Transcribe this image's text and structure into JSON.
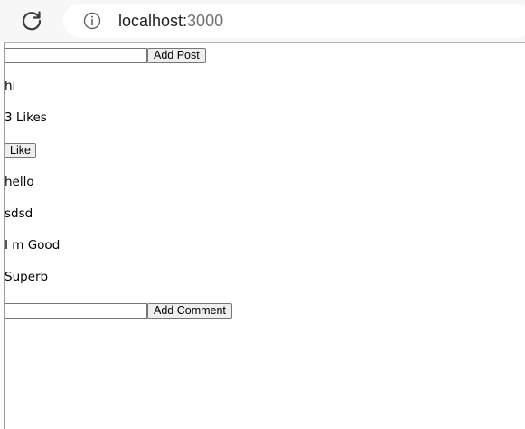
{
  "browser": {
    "url_host": "localhost:",
    "url_port": "3000"
  },
  "page": {
    "post_input_value": "",
    "add_post_label": "Add Post",
    "post_text": "hi",
    "likes_text": "3 Likes",
    "like_label": "Like",
    "comments": [
      "hello",
      "sdsd",
      "I m Good",
      "Superb"
    ],
    "comment_input_value": "",
    "add_comment_label": "Add Comment"
  },
  "colors": {
    "toolbar_bg": "#f7f7f7",
    "button_bg": "#efefef",
    "border": "#767676"
  },
  "icons": {
    "reload": "reload-icon",
    "info": "info-icon"
  }
}
